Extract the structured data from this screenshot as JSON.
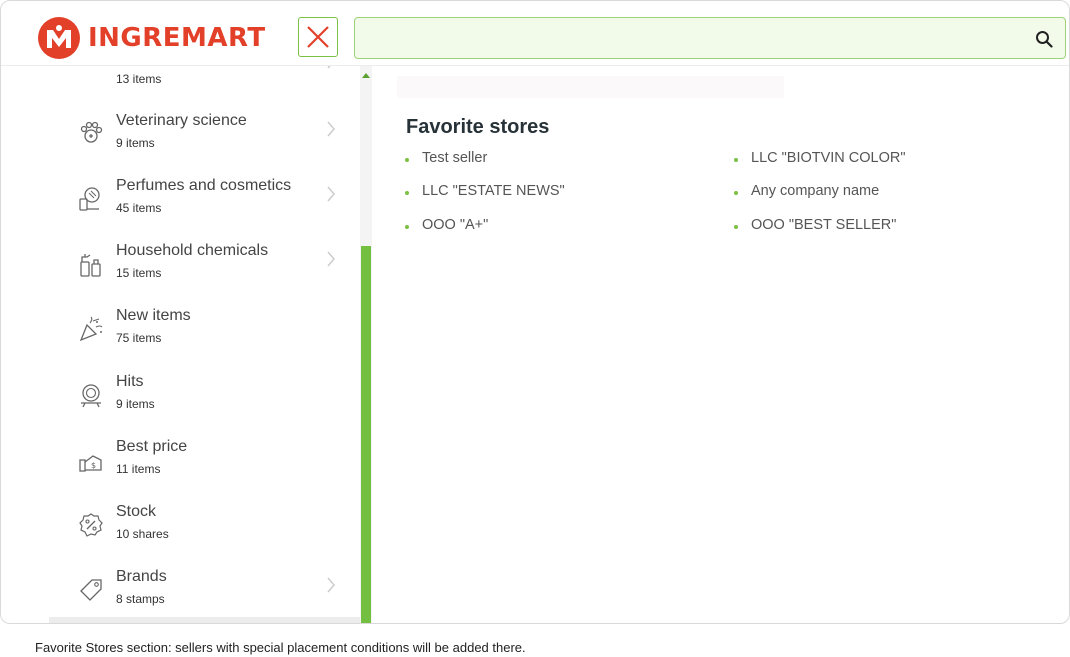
{
  "header": {
    "brand": "INGREMART",
    "search": {
      "value": "",
      "placeholder": ""
    }
  },
  "sidebar": {
    "items": [
      {
        "name": "",
        "count": "13 items",
        "icon": "partial-category-icon",
        "chevron": true
      },
      {
        "name": "Veterinary science",
        "count": "9 items",
        "icon": "paw-icon",
        "chevron": true
      },
      {
        "name": "Perfumes and cosmetics",
        "count": "45 items",
        "icon": "cosmetics-mirror-icon",
        "chevron": true
      },
      {
        "name": "Household chemicals",
        "count": "15 items",
        "icon": "cleaning-spray-icon",
        "chevron": true
      },
      {
        "name": "New items",
        "count": "75 items",
        "icon": "party-popper-icon",
        "chevron": false
      },
      {
        "name": "Hits",
        "count": "9 items",
        "icon": "award-badge-icon",
        "chevron": false
      },
      {
        "name": "Best price",
        "count": "11 items",
        "icon": "price-tag-hand-icon",
        "chevron": false
      },
      {
        "name": "Stock",
        "count": "10 shares",
        "icon": "percent-badge-icon",
        "chevron": false
      },
      {
        "name": "Brands",
        "count": "8 stamps",
        "icon": "tag-icon",
        "chevron": true
      }
    ]
  },
  "main": {
    "section_title": "Favorite stores",
    "stores": [
      "Test seller",
      "LLC \"BIOTVIN COLOR\"",
      "LLC \"ESTATE NEWS\"",
      "Any company name",
      "OOO \"A+\"",
      "OOO \"BEST SELLER\""
    ]
  },
  "caption": "Favorite Stores section: sellers with special placement conditions will be added there.",
  "colors": {
    "brand_red": "#e3402a",
    "accent_green": "#7bc143",
    "scroll_green": "#73c040"
  }
}
